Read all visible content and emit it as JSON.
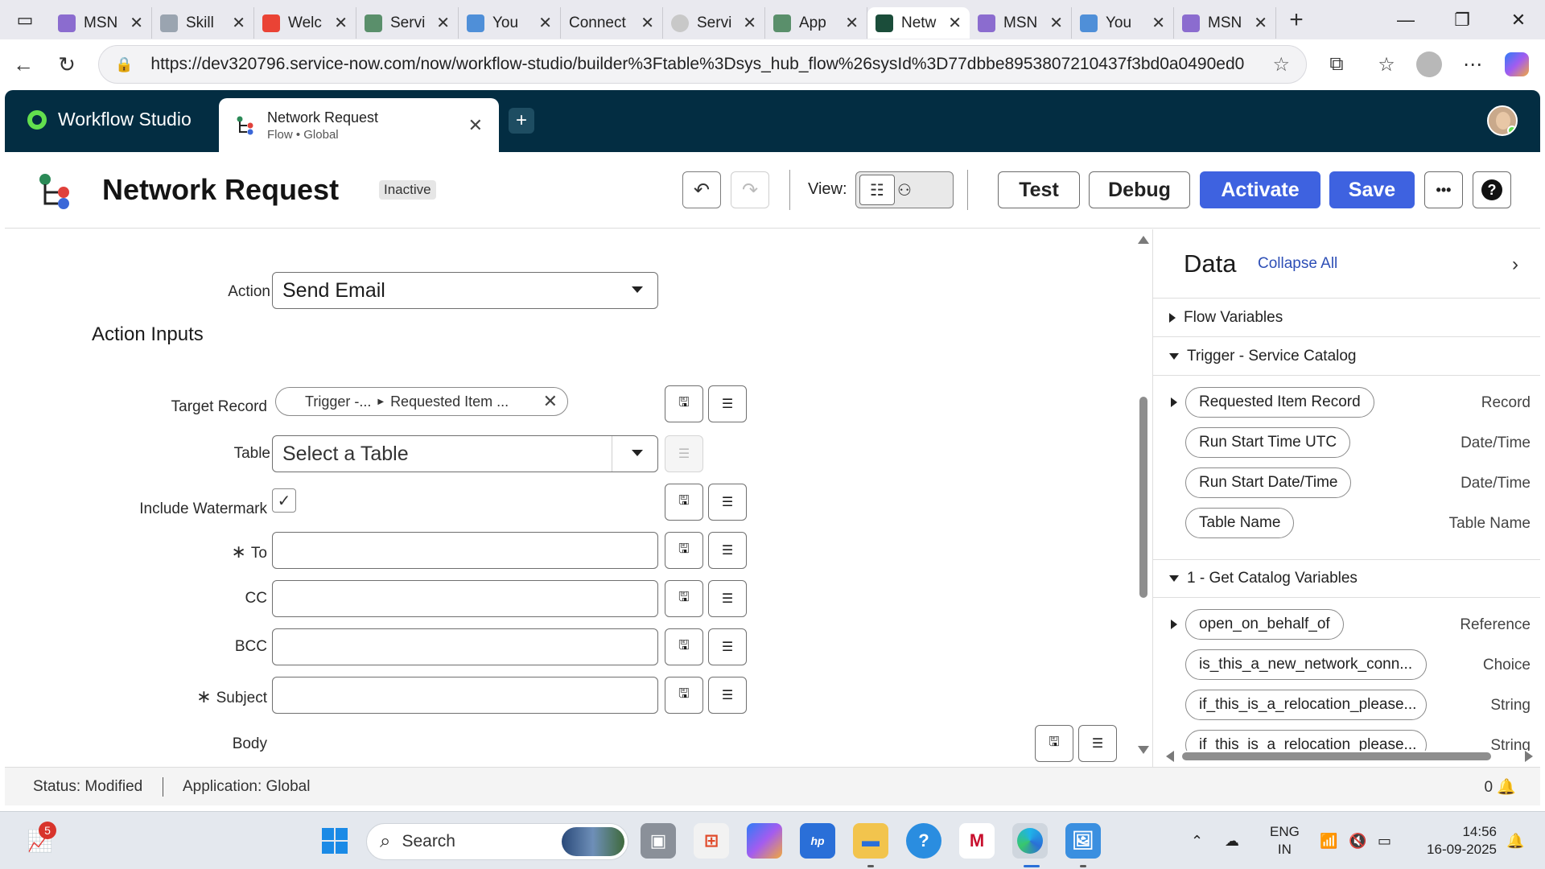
{
  "browser": {
    "tabs": [
      {
        "title": "MSN",
        "favicon_color": "#8b6ccf"
      },
      {
        "title": "Skill",
        "favicon_color": "#9aa4b0"
      },
      {
        "title": "Welc",
        "favicon_color": "#ea4335"
      },
      {
        "title": "Servi",
        "favicon_color": "#5a8f6b"
      },
      {
        "title": "You",
        "favicon_color": "#4f8fd8"
      },
      {
        "title": "Connect",
        "favicon_color": "#ffffff"
      },
      {
        "title": "Servi",
        "favicon_color": "#c8c8c8"
      },
      {
        "title": "App",
        "favicon_color": "#5a8f6b"
      },
      {
        "title": "Netw",
        "favicon_color": "#1b4d3a"
      },
      {
        "title": "MSN",
        "favicon_color": "#8b6ccf"
      },
      {
        "title": "You",
        "favicon_color": "#4f8fd8"
      },
      {
        "title": "MSN",
        "favicon_color": "#8b6ccf"
      }
    ],
    "active_tab_index": 8,
    "url": "https://dev320796.service-now.com/now/workflow-studio/builder%3Ftable%3Dsys_hub_flow%26sysId%3D77dbbe8953807210437f3bd0a0490ed0"
  },
  "app": {
    "name": "Workflow Studio",
    "tab": {
      "title": "Network Request",
      "subtitle": "Flow • Global"
    },
    "brand_color": "#032d42",
    "accent_green": "#63df4e"
  },
  "flow": {
    "title": "Network Request",
    "status": "Inactive",
    "view_label": "View:",
    "buttons": {
      "test": "Test",
      "debug": "Debug",
      "activate": "Activate",
      "save": "Save",
      "more": "•••",
      "help": "?"
    },
    "primary_color": "#3e62e0"
  },
  "form": {
    "action_label": "Action",
    "action_value": "Send Email",
    "section_title": "Action Inputs",
    "target_record": {
      "label": "Target Record",
      "pill_part1": "Trigger -...",
      "pill_part2": "Requested Item ..."
    },
    "table": {
      "label": "Table",
      "placeholder": "Select a Table"
    },
    "watermark": {
      "label": "Include Watermark",
      "checked": true
    },
    "to": {
      "label": "To",
      "required": true
    },
    "cc": {
      "label": "CC"
    },
    "bcc": {
      "label": "BCC"
    },
    "subject": {
      "label": "Subject",
      "required": true
    },
    "body": {
      "label": "Body"
    }
  },
  "data_panel": {
    "title": "Data",
    "collapse_all": "Collapse All",
    "groups": {
      "flow_variables": "Flow Variables",
      "trigger": "Trigger - Service Catalog",
      "catalog_vars": "1 - Get Catalog Variables"
    },
    "trigger_items": [
      {
        "name": "Requested Item Record",
        "type": "Record"
      },
      {
        "name": "Run Start Time UTC",
        "type": "Date/Time"
      },
      {
        "name": "Run Start Date/Time",
        "type": "Date/Time"
      },
      {
        "name": "Table Name",
        "type": "Table Name"
      }
    ],
    "catalog_items": [
      {
        "name": "open_on_behalf_of",
        "type": "Reference"
      },
      {
        "name": "is_this_a_new_network_conn...",
        "type": "Choice"
      },
      {
        "name": "if_this_is_a_relocation_please...",
        "type": "String"
      },
      {
        "name": "if_this_is_a_relocation_please...",
        "type": "String"
      }
    ]
  },
  "status_bar": {
    "status": "Status: Modified",
    "application": "Application: Global",
    "notifications": "0"
  },
  "taskbar": {
    "search_placeholder": "Search",
    "badge_count": "5",
    "language_line1": "ENG",
    "language_line2": "IN",
    "time": "14:56",
    "date": "16-09-2025"
  }
}
